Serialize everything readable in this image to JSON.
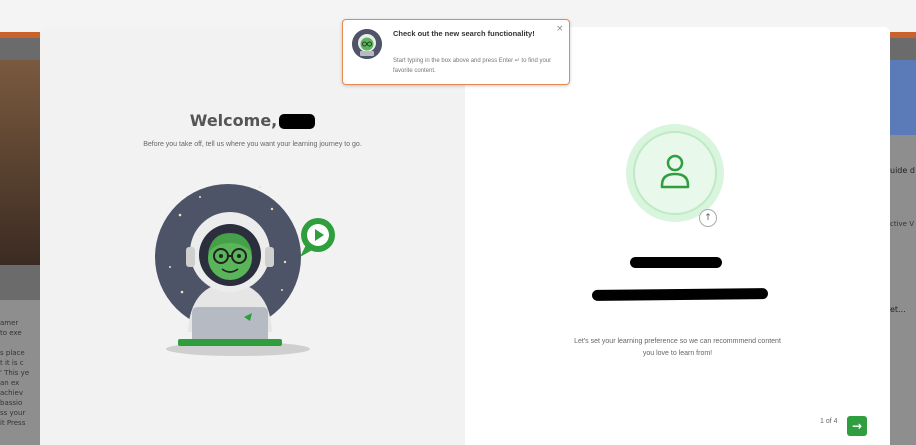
{
  "background": {
    "right_card_title": "uide d Med",
    "right_card_sub": "ctive V",
    "right_more": "et...",
    "left_lines": "amer\nto exe\n\ns place\nt it is c\n' This ye\nan ex\nachiev\nbassio\nss your\nit Press"
  },
  "tooltip": {
    "title": "Check out the new search functionality!",
    "body": "Start typing in the box above and press Enter ↵ to find your favorite content.",
    "close_glyph": "×"
  },
  "welcome": {
    "greeting": "Welcome,",
    "subtitle": "Before you take off, tell us where you want your learning journey to go."
  },
  "profile": {
    "upload_glyph": "↑",
    "preference_text": "Let's set your learning preference so we can recommmend content you love to learn from!"
  },
  "pagination": {
    "label": "1 of 4",
    "next_glyph": "→"
  },
  "colors": {
    "accent_green": "#2e9e3e",
    "tooltip_border": "#e58a4e",
    "topbar_accent": "#c9632b"
  }
}
